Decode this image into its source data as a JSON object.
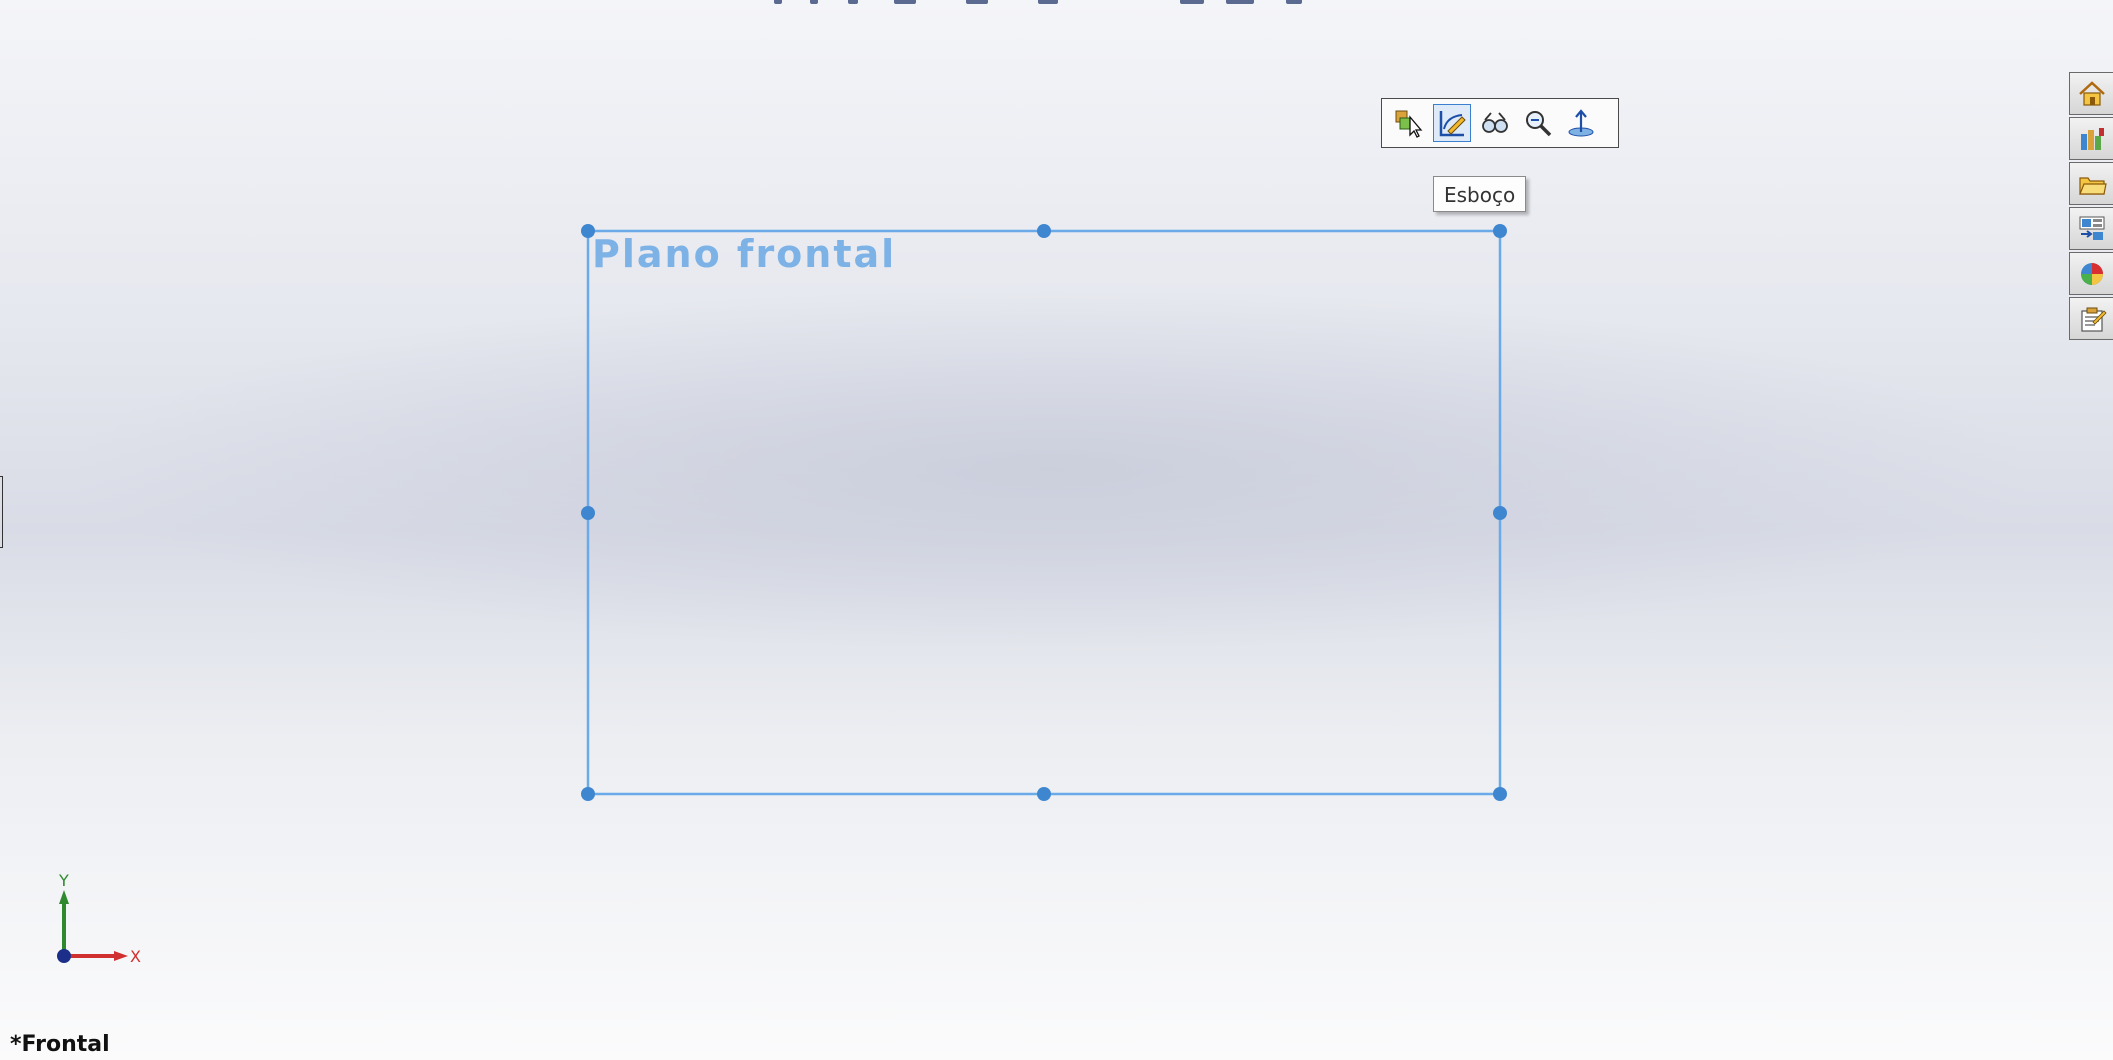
{
  "context_toolbar": {
    "buttons": [
      {
        "name": "select-other-icon",
        "active": false
      },
      {
        "name": "sketch-icon",
        "active": true
      },
      {
        "name": "show-hide-icon",
        "active": false
      },
      {
        "name": "zoom-to-selection-icon",
        "active": false
      },
      {
        "name": "normal-to-icon",
        "active": false
      }
    ],
    "tooltip": "Esboço"
  },
  "plane": {
    "label": "Plano frontal",
    "color": "#6aaae8"
  },
  "task_pane": {
    "tabs": [
      {
        "name": "home-icon"
      },
      {
        "name": "design-library-icon"
      },
      {
        "name": "file-explorer-icon"
      },
      {
        "name": "view-palette-icon"
      },
      {
        "name": "appearances-icon"
      },
      {
        "name": "custom-properties-icon"
      }
    ]
  },
  "triad": {
    "x_label": "X",
    "y_label": "Y"
  },
  "view": {
    "name": "*Frontal"
  }
}
